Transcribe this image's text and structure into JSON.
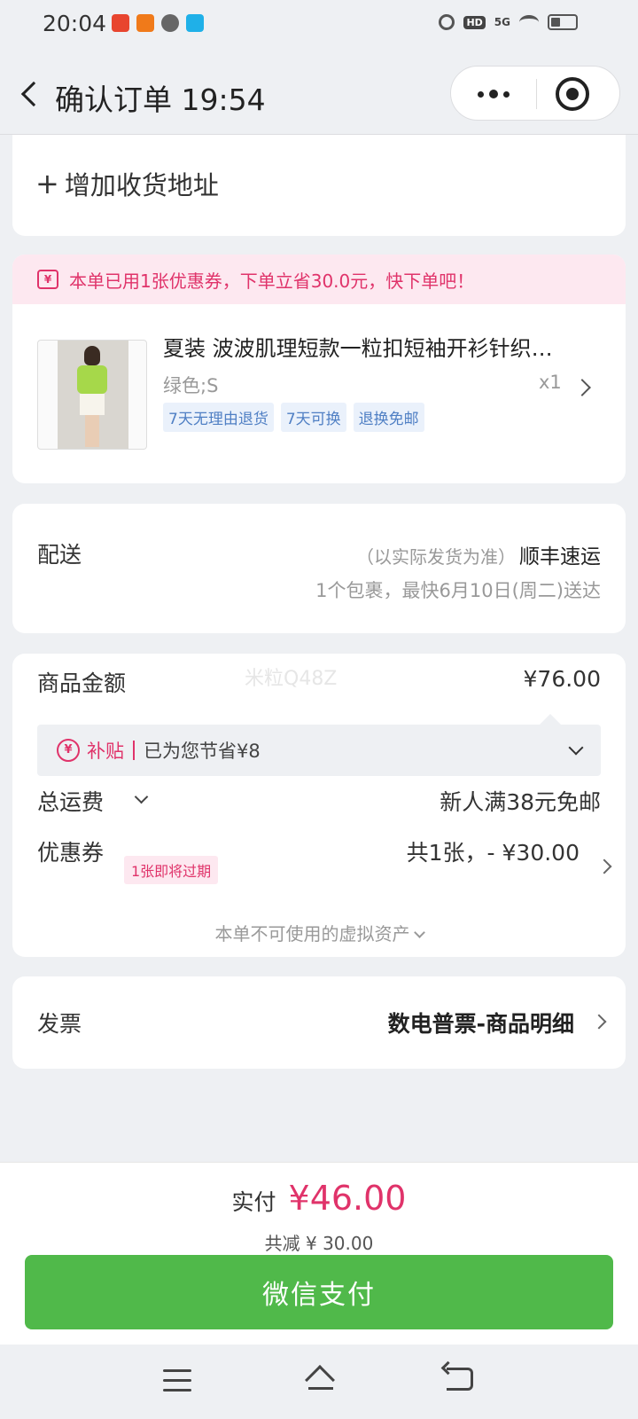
{
  "status_bar": {
    "time": "20:04",
    "hd": "HD",
    "network": "5G"
  },
  "nav": {
    "title": "确认订单 19:54"
  },
  "address": {
    "add_label": "增加收货地址"
  },
  "coupon_banner": {
    "text": "本单已用1张优惠券，下单立省30.0元，快下单吧！",
    "icon_text": "¥"
  },
  "product": {
    "title": "夏装 波波肌理短款一粒扣短袖开衫针织…",
    "spec": "绿色;S",
    "qty": "x1",
    "tags": [
      "7天无理由退货",
      "7天可换",
      "退换免邮"
    ]
  },
  "shipping": {
    "label": "配送",
    "note": "（以实际发货为准）",
    "carrier": "顺丰速运",
    "eta": "1个包裹，最快6月10日(周二)送达"
  },
  "price": {
    "goods_label": "商品金额",
    "goods_value": "¥76.00",
    "watermark": "米粒Q48Z",
    "subsidy_icon": "¥",
    "subsidy_label": "补贴",
    "subsidy_text": "已为您节省¥8",
    "freight_label": "总运费",
    "freight_value": "新人满38元免邮",
    "coupon_label": "优惠券",
    "coupon_badge": "1张即将过期",
    "coupon_value": "共1张，- ¥30.00",
    "virtual_assets": "本单不可使用的虚拟资产"
  },
  "invoice": {
    "label": "发票",
    "value": "数电普票-商品明细"
  },
  "footer": {
    "pay_label": "实付",
    "pay_amount": "¥46.00",
    "saved": "共减 ¥ 30.00",
    "pay_button": "微信支付"
  },
  "colors": {
    "accent": "#e0336a",
    "pay_button": "#50b94a",
    "tag_text": "#4f7fc4"
  }
}
